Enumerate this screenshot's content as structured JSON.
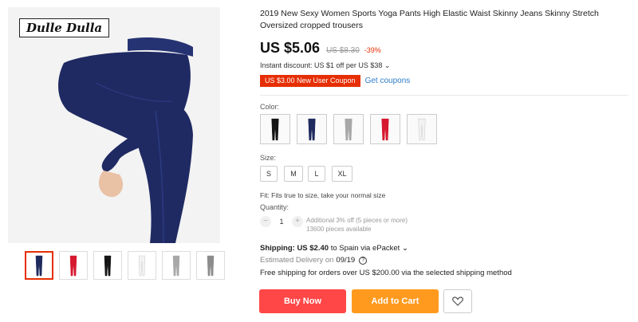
{
  "product": {
    "brand": "Dulle Dulla",
    "title": "2019 New Sexy Women Sports Yoga Pants High Elastic Waist Skinny Jeans Skinny Stretch Oversized cropped trousers"
  },
  "pricing": {
    "price": "US $5.06",
    "original": "US $8.30",
    "discount": "-39%",
    "instant_discount": "Instant discount: US $1 off per US $38 ⌄",
    "coupon": "US $3.00 New User Coupon",
    "get_coupons": "Get coupons"
  },
  "color": {
    "label": "Color:",
    "options": [
      "black",
      "navy",
      "gray",
      "red",
      "white"
    ],
    "swatch_colors": [
      "#151515",
      "#1e2a5e",
      "#a8a8a8",
      "#d6192f",
      "#f2f2f2"
    ]
  },
  "size": {
    "label": "Size:",
    "options": [
      "S",
      "M",
      "L",
      "XL"
    ],
    "fit": "Fit: Fits true to size, take your normal size"
  },
  "quantity": {
    "label": "Quantity:",
    "value": "1",
    "minus": "−",
    "plus": "+",
    "note1": "Additional 3% off (5 pieces or more)",
    "note2": "13600 pieces available"
  },
  "shipping": {
    "label": "Shipping:",
    "cost": "US $2.40",
    "dest": " to Spain via ePacket ⌄",
    "est_label": "Estimated Delivery on",
    "est_date": "09/19",
    "free": "Free shipping for orders over US $200.00 via the selected shipping method"
  },
  "actions": {
    "buy": "Buy Now",
    "cart": "Add to Cart"
  },
  "thumbnails": {
    "colors": [
      "#1e2a5e",
      "#d6192f",
      "#151515",
      "#f2f2f2",
      "#a8a8a8",
      "#8c8c8c"
    ]
  },
  "colors": {
    "accent": "#e62e04",
    "buy": "#ff4747",
    "cart": "#ff9a1f",
    "link": "#2e7cc7"
  }
}
